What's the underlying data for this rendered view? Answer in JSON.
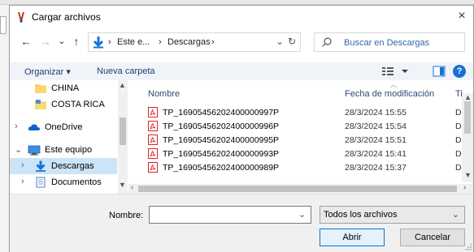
{
  "window": {
    "title": "Cargar archivos",
    "close_label": "×"
  },
  "nav": {
    "back": "←",
    "forward": "→",
    "recent": "⌄",
    "up": "↑",
    "breadcrumb": [
      "Este e...",
      "Descargas"
    ],
    "breadcrumb_sep": "›",
    "address_dropdown": "⌄",
    "refresh": "↻",
    "search_placeholder": "Buscar en Descargas"
  },
  "toolbar": {
    "organize_label": "Organizar ▾",
    "new_folder_label": "Nueva carpeta",
    "help_label": "?"
  },
  "sidebar": {
    "items": [
      {
        "label": "CHINA",
        "icon": "folder-icon",
        "chevron": ""
      },
      {
        "label": "COSTA RICA",
        "icon": "folder-icon",
        "chevron": ""
      },
      {
        "label": "OneDrive",
        "icon": "cloud-icon",
        "chevron": "›"
      },
      {
        "label": "Este equipo",
        "icon": "computer-icon",
        "chevron": "⌄"
      },
      {
        "label": "Descargas",
        "icon": "download-icon",
        "chevron": "›"
      },
      {
        "label": "Documentos",
        "icon": "documents-icon",
        "chevron": "›"
      }
    ],
    "scroll_up": "▲",
    "scroll_down": "▼"
  },
  "files": {
    "columns": {
      "name": "Nombre",
      "date": "Fecha de modificación",
      "type": "Ti"
    },
    "rows": [
      {
        "name": "TP_16905456202400000997P",
        "date": "28/3/2024 15:55",
        "type": "Do"
      },
      {
        "name": "TP_16905456202400000996P",
        "date": "28/3/2024 15:54",
        "type": "Do"
      },
      {
        "name": "TP_16905456202400000995P",
        "date": "28/3/2024 15:51",
        "type": "Do"
      },
      {
        "name": "TP_16905456202400000993P",
        "date": "28/3/2024 15:41",
        "type": "Do"
      },
      {
        "name": "TP_16905456202400000989P",
        "date": "28/3/2024 15:37",
        "type": "Do"
      }
    ],
    "scroll_up": "▲",
    "scroll_down": "▼",
    "scroll_left": "‹",
    "scroll_right": "›"
  },
  "footer": {
    "name_label": "Nombre:",
    "name_value": "",
    "name_dropdown": "⌄",
    "filter_value": "Todos los archivos",
    "filter_dropdown": "⌄",
    "open_label": "Abrir",
    "cancel_label": "Cancelar"
  },
  "colors": {
    "accent": "#0078d7",
    "selection": "#cce4f7",
    "toolbar_bg": "#f0f4f9",
    "pdf_red": "#d9252b"
  }
}
